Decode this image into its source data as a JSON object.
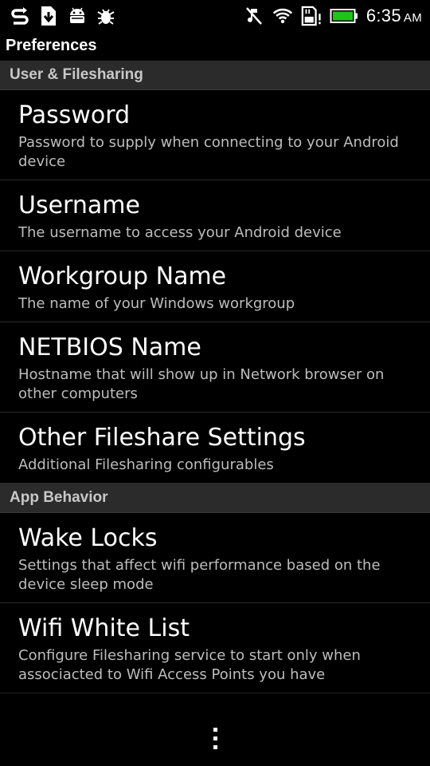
{
  "status_bar": {
    "time": "6:35",
    "ampm": "AM",
    "icons_left": [
      "sync-icon",
      "download-icon",
      "android-icon",
      "bug-icon"
    ],
    "icons_right": [
      "mute-icon",
      "wifi-icon",
      "sd-card-icon",
      "battery-icon"
    ],
    "battery_color": "#22c21c"
  },
  "app": {
    "title": "Preferences"
  },
  "sections": [
    {
      "header": "User & Filesharing",
      "items": [
        {
          "title": "Password",
          "summary": "Password to supply when connecting to your Android device"
        },
        {
          "title": "Username",
          "summary": "The username to access your Android device"
        },
        {
          "title": "Workgroup Name",
          "summary": "The name of your Windows workgroup"
        },
        {
          "title": "NETBIOS Name",
          "summary": "Hostname that will show up in Network browser on other computers"
        },
        {
          "title": "Other Fileshare Settings",
          "summary": "Additional Filesharing configurables"
        }
      ]
    },
    {
      "header": "App Behavior",
      "items": [
        {
          "title": "Wake Locks",
          "summary": "Settings that affect wifi performance based on the device sleep mode"
        },
        {
          "title": "Wifi White List",
          "summary": "Configure Filesharing service to start only when associacted to Wifi Access Points you have"
        }
      ]
    }
  ],
  "navbar": {
    "menu_icon": "overflow-menu-icon"
  }
}
